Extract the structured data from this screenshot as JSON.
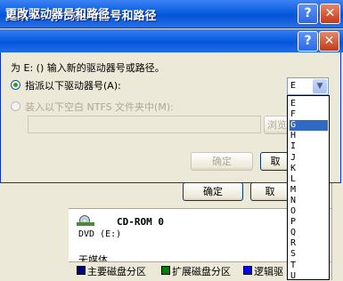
{
  "back_window": {
    "title": "更改 E: () 的驱动器号和路径",
    "ok_label": "确定",
    "cancel_label": "取",
    "disk_label": "CD-ROM 0",
    "disk_sub": "DVD (E:)",
    "no_media": "无媒体",
    "legend": [
      "主要磁盘分区",
      "扩展磁盘分区",
      "逻辑驱"
    ],
    "legend_colors": [
      "#000080",
      "#008000",
      "#0000ff"
    ]
  },
  "dialog": {
    "title": "更改驱动器号和路径",
    "instruction": "为 E: () 输入新的驱动器号或路径。",
    "option_assign": "指派以下驱动器号(A):",
    "option_mount": "装入以下空白 NTFS 文件夹中(M):",
    "browse_label": "浏览",
    "ok_label": "确定",
    "cancel_label": "取",
    "selected_letter": "E"
  },
  "drive_letters": [
    "E",
    "F",
    "G",
    "H",
    "I",
    "J",
    "K",
    "L",
    "M",
    "N",
    "O",
    "P",
    "Q",
    "R",
    "S",
    "T",
    "U"
  ],
  "selected_index": 2
}
